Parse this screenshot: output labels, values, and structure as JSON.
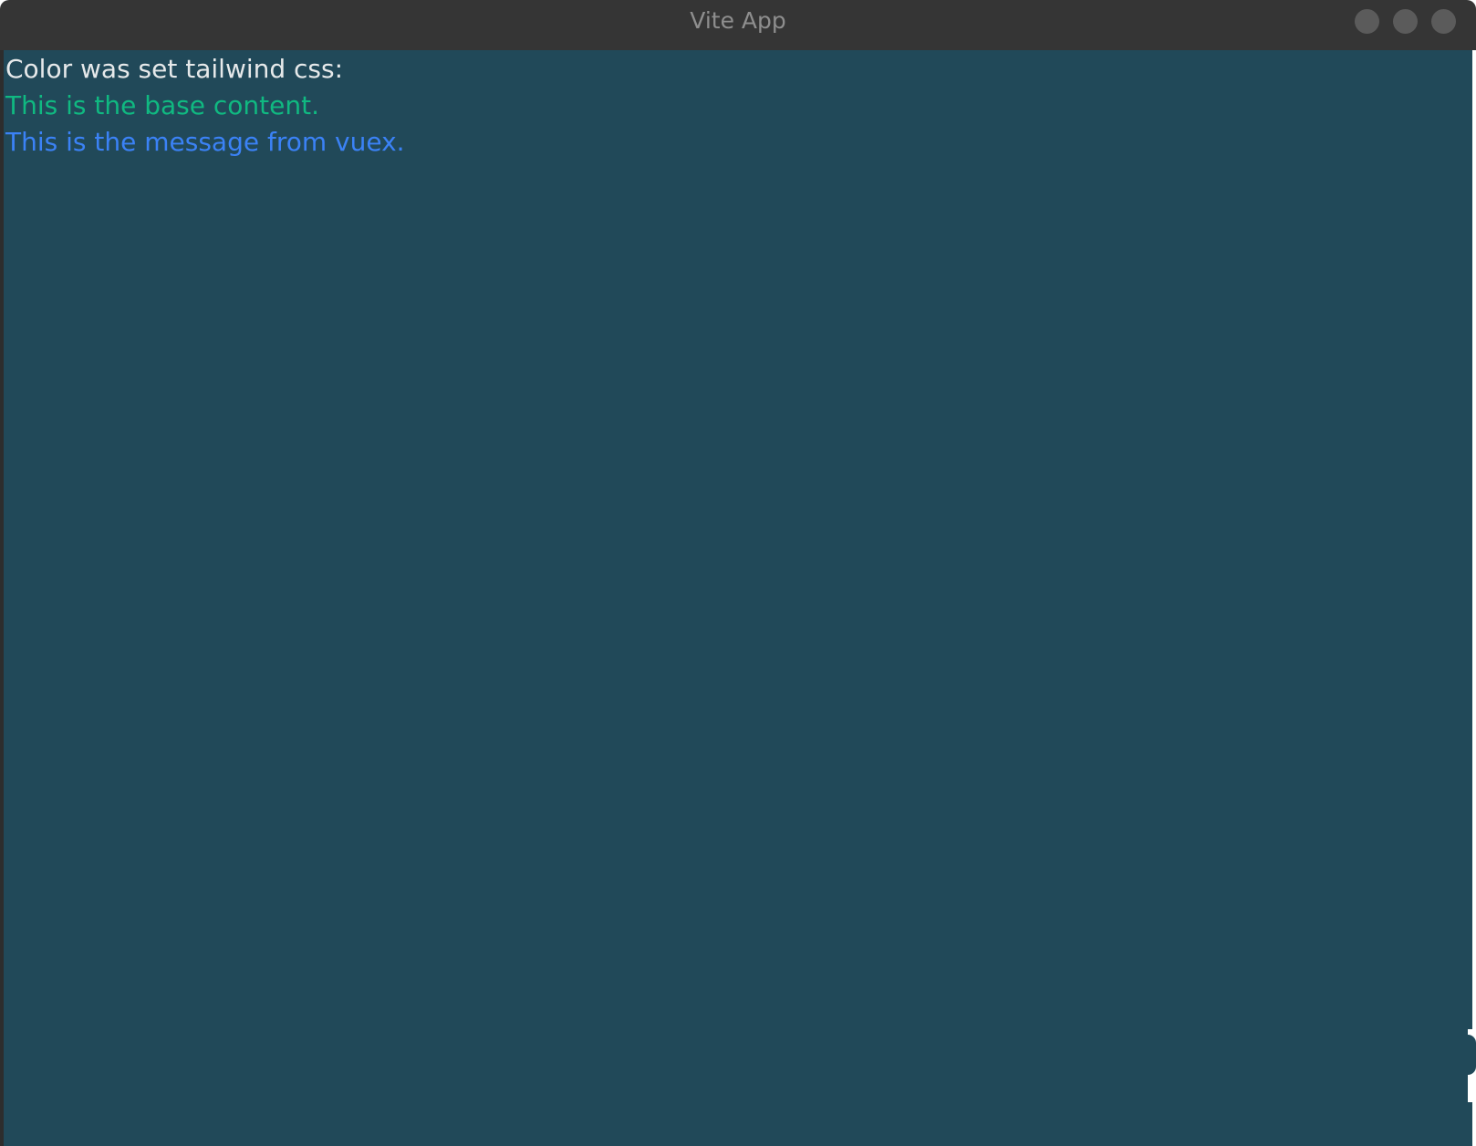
{
  "window": {
    "title": "Vite App",
    "controls": [
      "minimize-icon",
      "maximize-icon",
      "close-icon"
    ]
  },
  "content": {
    "heading": "Color was set tailwind css:",
    "base_text": "This is the base content.",
    "vuex_text": "This is the message from vuex."
  },
  "colors": {
    "titlebar": "#353535",
    "background": "#214959",
    "heading_text": "#e6e9ea",
    "base_text": "#10b981",
    "vuex_text": "#3b82f6"
  }
}
